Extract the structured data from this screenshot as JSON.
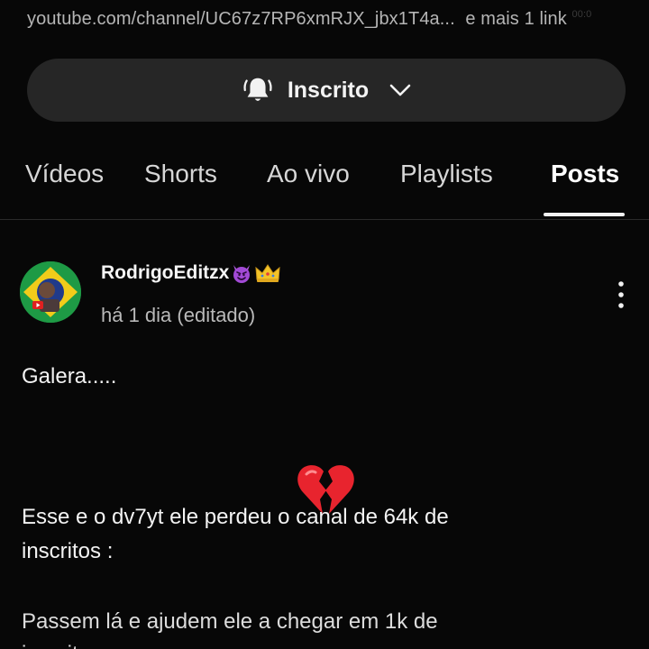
{
  "header": {
    "url": "youtube.com/channel/UC67z7RP6xmRJX_jbx1T4a...",
    "more_links": "e mais 1 link",
    "overlay_fragment": "00:0"
  },
  "subscribe": {
    "label": "Inscrito"
  },
  "tabs": [
    {
      "label": "Vídeos",
      "active": false
    },
    {
      "label": "Shorts",
      "active": false
    },
    {
      "label": "Ao vivo",
      "active": false
    },
    {
      "label": "Playlists",
      "active": false
    },
    {
      "label": "Posts",
      "active": true
    }
  ],
  "post": {
    "author": "RodrigoEditzx",
    "time": "há 1 dia (editado)",
    "lines": [
      "Galera.....",
      "Esse e o dv7yt ele perdeu o canal de 64k de",
      "inscritos :",
      "Passem lá e ajudem ele a chegar em 1k de",
      "inscritos"
    ]
  },
  "icons": {
    "bell": "bell-ringing-icon",
    "chevron": "chevron-down-icon",
    "more": "more-vertical-icon",
    "emoji_devil": "smiling-devil-emoji",
    "emoji_crown": "crown-emoji",
    "broken_heart": "broken-heart-emoji"
  },
  "colors": {
    "background": "#070707",
    "pill": "#262626",
    "text_primary": "#f1f1f1",
    "text_secondary": "#b9b9b9"
  }
}
